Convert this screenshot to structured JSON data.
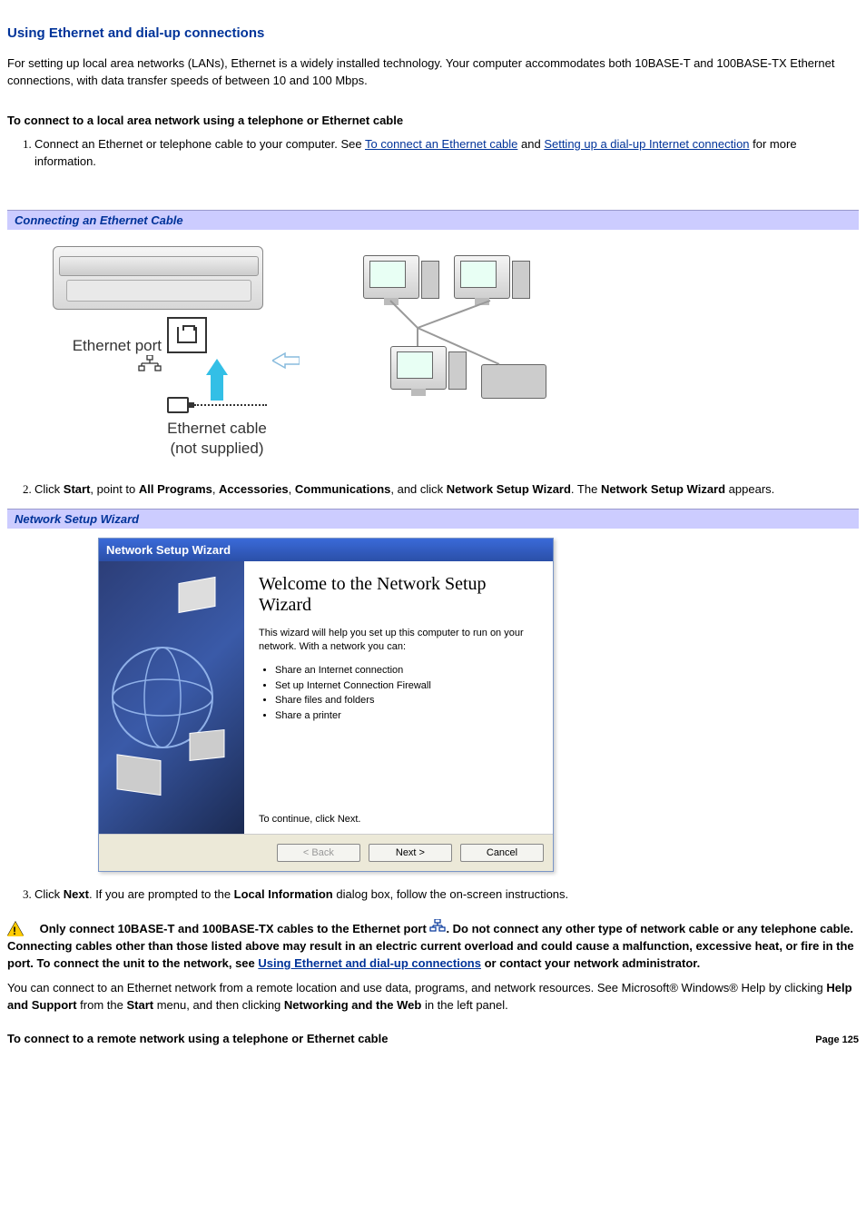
{
  "title": "Using Ethernet and dial-up connections",
  "intro": "For setting up local area networks (LANs), Ethernet is a widely installed technology. Your computer accommodates both 10BASE-T and 100BASE-TX Ethernet connections, with data transfer speeds of between 10 and 100 Mbps.",
  "subhead1": "To connect to a local area network using a telephone or Ethernet cable",
  "step1_pre": "Connect an Ethernet or telephone cable to your computer. See ",
  "step1_link1": "To connect an Ethernet cable",
  "step1_mid": " and ",
  "step1_link2": "Setting up a dial-up Internet connection",
  "step1_post": " for more information.",
  "section_eth": "Connecting an Ethernet Cable",
  "eth_port_label": "Ethernet port",
  "eth_cable_label1": "Ethernet cable",
  "eth_cable_label2": "(not supplied)",
  "step2_pre": "Click ",
  "step2_b1": "Start",
  "step2_t1": ", point to ",
  "step2_b2": "All Programs",
  "step2_t2": ", ",
  "step2_b3": "Accessories",
  "step2_t3": ", ",
  "step2_b4": "Communications",
  "step2_t4": ", and click ",
  "step2_b5": "Network Setup Wizard",
  "step2_t5": ". The ",
  "step2_b6": "Network Setup Wizard",
  "step2_t6": " appears.",
  "section_wiz": "Network Setup Wizard",
  "wizard": {
    "titlebar": "Network Setup Wizard",
    "heading": "Welcome to the Network Setup Wizard",
    "desc": "This wizard will help you set up this computer to run on your network. With a network you can:",
    "bullets": [
      "Share an Internet connection",
      "Set up Internet Connection Firewall",
      "Share files and folders",
      "Share a printer"
    ],
    "continue": "To continue, click Next.",
    "back": "< Back",
    "next": "Next >",
    "cancel": "Cancel"
  },
  "step3_pre": "Click ",
  "step3_b1": "Next",
  "step3_mid": ". If you are prompted to the ",
  "step3_b2": "Local Information",
  "step3_post": " dialog box, follow the on-screen instructions.",
  "warning_pre": "Only connect 10BASE-T and 100BASE-TX cables to the Ethernet port ",
  "warning_mid": ". Do not connect any other type of network cable or any telephone cable. Connecting cables other than those listed above may result in an electric current overload and could cause a malfunction, excessive heat, or fire in the port. To connect the unit to the network, see ",
  "warning_link": "Using Ethernet and dial-up connections",
  "warning_post": " or contact your network administrator.",
  "remote_pre": "You can connect to an Ethernet network from a remote location and use data, programs, and network resources. See Microsoft® Windows® Help by clicking ",
  "remote_b1": "Help and Support",
  "remote_t1": " from the ",
  "remote_b2": "Start",
  "remote_t2": " menu, and then clicking ",
  "remote_b3": "Networking and the Web",
  "remote_t3": " in the left panel.",
  "subhead2": "To connect to a remote network using a telephone or Ethernet cable",
  "page_num": "Page 125"
}
